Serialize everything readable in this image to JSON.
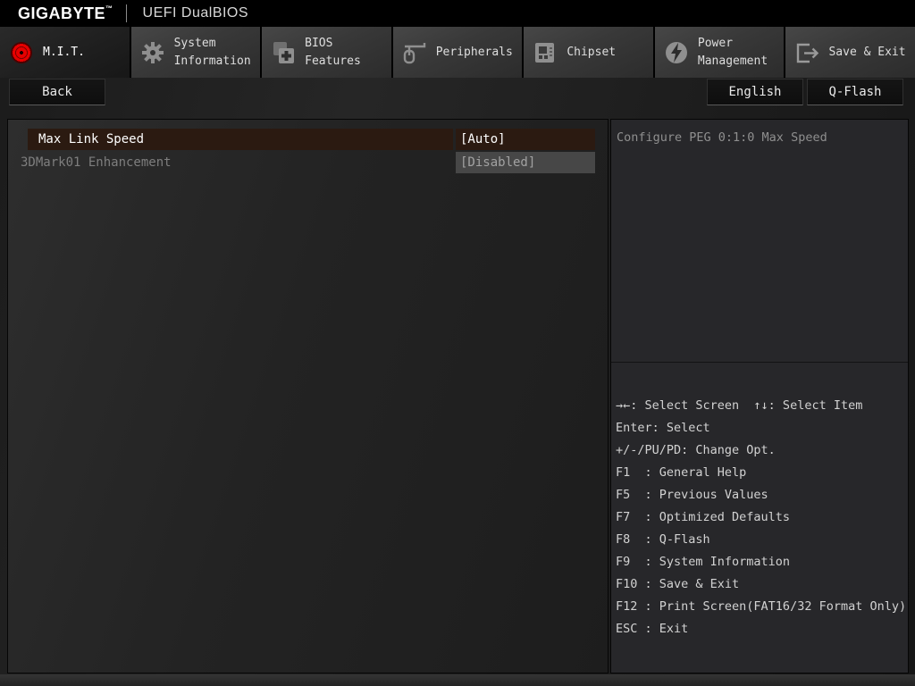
{
  "header": {
    "logo": "GIGABYTE",
    "logo_tm": "™",
    "firmware_title": "UEFI DualBIOS"
  },
  "tabs": [
    {
      "label": "M.I.T.",
      "icon": "mit-dial-icon",
      "active": true
    },
    {
      "label": "System Information",
      "icon": "gear-icon",
      "active": false
    },
    {
      "label": "BIOS Features",
      "icon": "chip-plus-icon",
      "active": false
    },
    {
      "label": "Peripherals",
      "icon": "peripherals-icon",
      "active": false
    },
    {
      "label": "Chipset",
      "icon": "chipset-icon",
      "active": false
    },
    {
      "label": "Power Management",
      "icon": "power-bolt-icon",
      "active": false
    },
    {
      "label": "Save & Exit",
      "icon": "exit-door-icon",
      "active": false
    }
  ],
  "toolbar": {
    "back_label": "Back",
    "language_label": "English",
    "qflash_label": "Q-Flash"
  },
  "settings": [
    {
      "label": "Max Link Speed",
      "value": "[Auto]",
      "selected": true
    },
    {
      "label": "3DMark01 Enhancement",
      "value": "[Disabled]",
      "selected": false
    }
  ],
  "help": {
    "description": "Configure PEG 0:1:0 Max Speed",
    "keys": [
      "→←: Select Screen  ↑↓: Select Item",
      "Enter: Select",
      "+/-/PU/PD: Change Opt.",
      "F1  : General Help",
      "F5  : Previous Values",
      "F7  : Optimized Defaults",
      "F8  : Q-Flash",
      "F9  : System Information",
      "F10 : Save & Exit",
      "F12 : Print Screen(FAT16/32 Format Only)",
      "ESC : Exit"
    ]
  },
  "colors": {
    "brand_red": "#e60000",
    "selected_row_bg": "#2b1a11",
    "inactive_value_bg": "#474747",
    "panel_bg": "#27272a"
  }
}
